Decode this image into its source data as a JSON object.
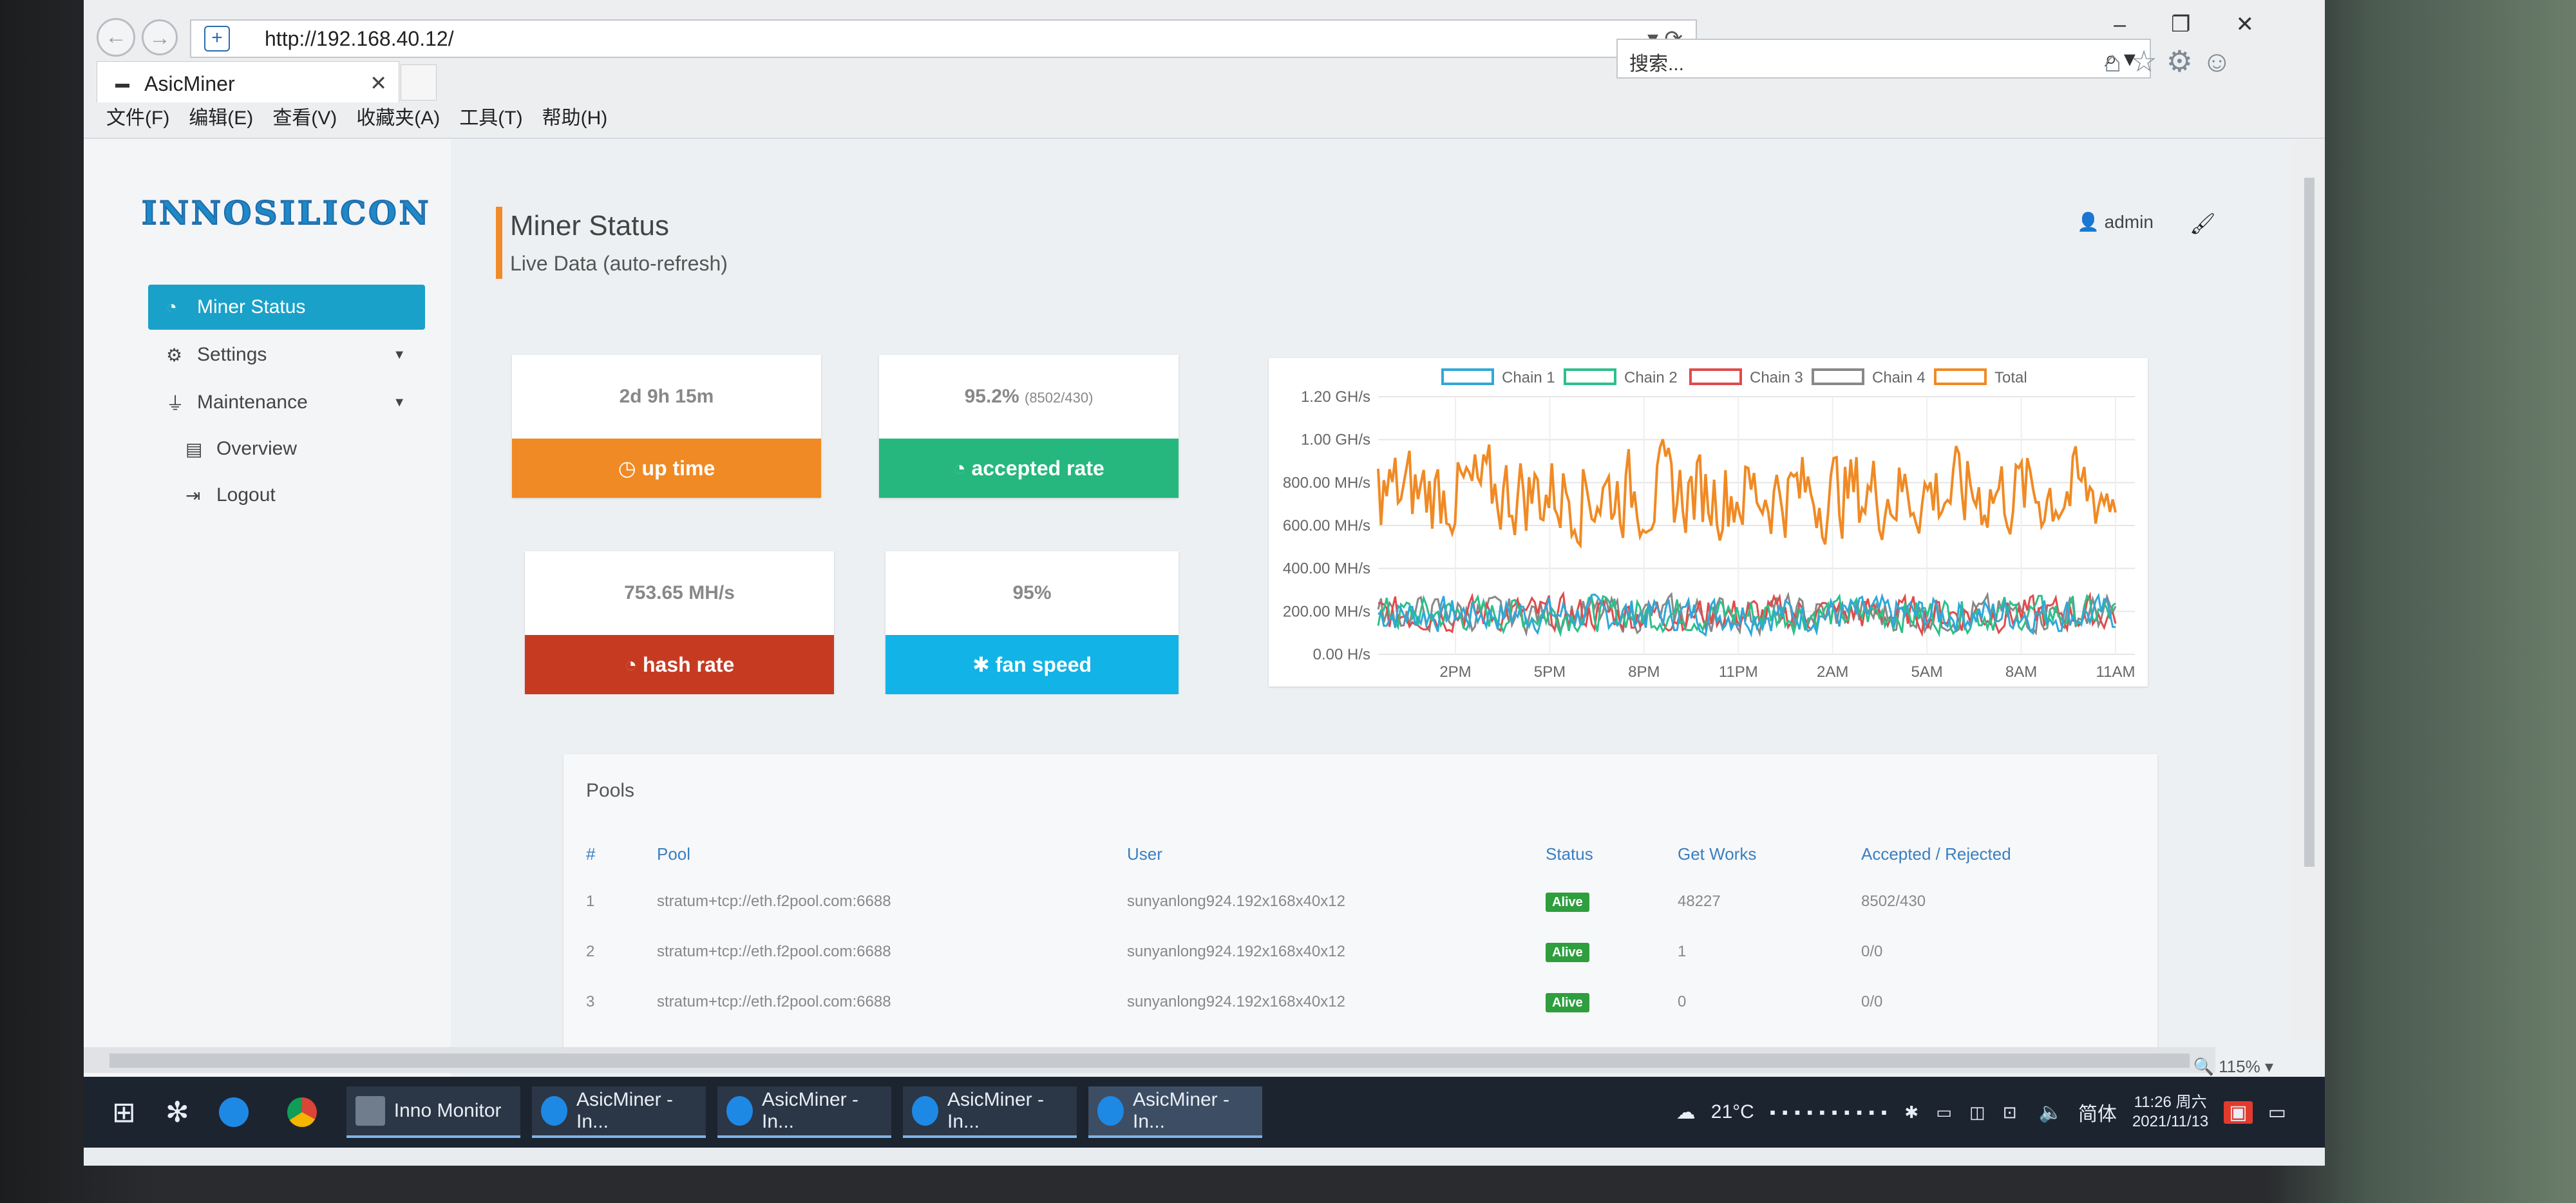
{
  "browser": {
    "url": "http://192.168.40.12/",
    "search_placeholder": "搜索...",
    "tab_title": "AsicMiner",
    "menu": [
      "文件(F)",
      "编辑(E)",
      "查看(V)",
      "收藏夹(A)",
      "工具(T)",
      "帮助(H)"
    ]
  },
  "sidebar": {
    "logo": "INNOSILICON",
    "items": [
      {
        "label": "Miner Status",
        "icon": "dashboard-icon"
      },
      {
        "label": "Settings",
        "icon": "cogs-icon"
      },
      {
        "label": "Maintenance",
        "icon": "plug-icon"
      },
      {
        "label": "Overview",
        "icon": "book-icon"
      },
      {
        "label": "Logout",
        "icon": "sign-out-icon"
      }
    ]
  },
  "header": {
    "title": "Miner Status",
    "subtitle": "Live Data (auto-refresh)",
    "user": "admin"
  },
  "stats": {
    "uptime": {
      "value": "2d 9h 15m",
      "label": "up time",
      "color": "#f08a24"
    },
    "accepted": {
      "value": "95.2%",
      "detail": "(8502/430)",
      "label": "accepted rate",
      "color": "#26b77e"
    },
    "hashrate": {
      "value": "753.65 MH/s",
      "label": "hash rate",
      "color": "#c73a22"
    },
    "fan": {
      "value": "95%",
      "label": "fan speed",
      "color": "#12b3e6"
    }
  },
  "chart_data": {
    "type": "line",
    "legend": [
      "Chain 1",
      "Chain 2",
      "Chain 3",
      "Chain 4",
      "Total"
    ],
    "colors": [
      "#2fa8d8",
      "#2cc08a",
      "#e04b4b",
      "#888888",
      "#f08a24"
    ],
    "yticks": [
      "1.20 GH/s",
      "1.00 GH/s",
      "800.00 MH/s",
      "600.00 MH/s",
      "400.00 MH/s",
      "200.00 MH/s",
      "0.00 H/s"
    ],
    "xticks": [
      "2PM",
      "5PM",
      "8PM",
      "11PM",
      "2AM",
      "5AM",
      "8AM",
      "11AM"
    ],
    "ylim": [
      0,
      1200
    ],
    "total_mean_mhs": 753,
    "chain_mean_mhs": 188
  },
  "pools": {
    "title": "Pools",
    "headers": [
      "#",
      "Pool",
      "User",
      "Status",
      "Get Works",
      "Accepted / Rejected"
    ],
    "rows": [
      [
        "1",
        "stratum+tcp://eth.f2pool.com:6688",
        "sunyanlong924.192x168x40x12",
        "Alive",
        "48227",
        "8502/430"
      ],
      [
        "2",
        "stratum+tcp://eth.f2pool.com:6688",
        "sunyanlong924.192x168x40x12",
        "Alive",
        "1",
        "0/0"
      ],
      [
        "3",
        "stratum+tcp://eth.f2pool.com:6688",
        "sunyanlong924.192x168x40x12",
        "Alive",
        "0",
        "0/0"
      ]
    ]
  },
  "statusbar": {
    "zoom": "115%"
  },
  "taskbar": {
    "items": [
      "Inno Monitor",
      "AsicMiner - In...",
      "AsicMiner - In...",
      "AsicMiner - In...",
      "AsicMiner - In..."
    ],
    "weather": "21°C",
    "ime": "简体",
    "time": "11:26 周六",
    "date": "2021/11/13"
  }
}
